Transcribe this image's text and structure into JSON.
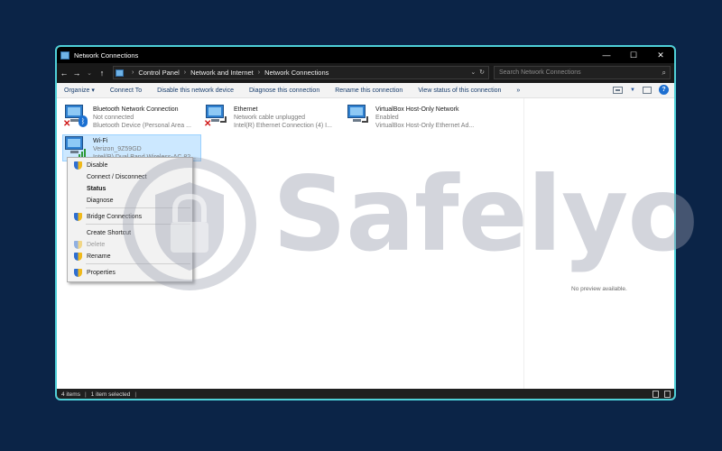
{
  "window": {
    "title": "Network Connections",
    "min": "—",
    "max": "☐",
    "close": "✕"
  },
  "address": {
    "breadcrumbs": [
      "Control Panel",
      "Network and Internet",
      "Network Connections"
    ],
    "search_placeholder": "Search Network Connections"
  },
  "commands": [
    "Organize ▾",
    "Connect To",
    "Disable this network device",
    "Diagnose this connection",
    "Rename this connection",
    "View status of this connection",
    "»"
  ],
  "connections": [
    {
      "name": "Bluetooth Network Connection",
      "status": "Not connected",
      "device": "Bluetooth Device (Personal Area ..."
    },
    {
      "name": "Ethernet",
      "status": "Network cable unplugged",
      "device": "Intel(R) Ethernet Connection (4) I..."
    },
    {
      "name": "VirtualBox Host-Only Network",
      "status": "Enabled",
      "device": "VirtualBox Host-Only Ethernet Ad..."
    },
    {
      "name": "Wi-Fi",
      "status": "Verizon_9Z59GD",
      "device": "Intel(R) Dual Band Wireless-AC 82..."
    }
  ],
  "context_menu": [
    "Disable",
    "Connect / Disconnect",
    "Status",
    "Diagnose",
    "Bridge Connections",
    "Create Shortcut",
    "Delete",
    "Rename",
    "Properties"
  ],
  "preview": {
    "text": "No preview available."
  },
  "status": {
    "items": "4 items",
    "selected": "1 item selected"
  },
  "watermark": {
    "text": "Safelyo"
  },
  "colors": {
    "background": "#0b2447",
    "window_border": "#4fd0d8",
    "selection": "#cce8ff",
    "watermark": "#969bac"
  }
}
